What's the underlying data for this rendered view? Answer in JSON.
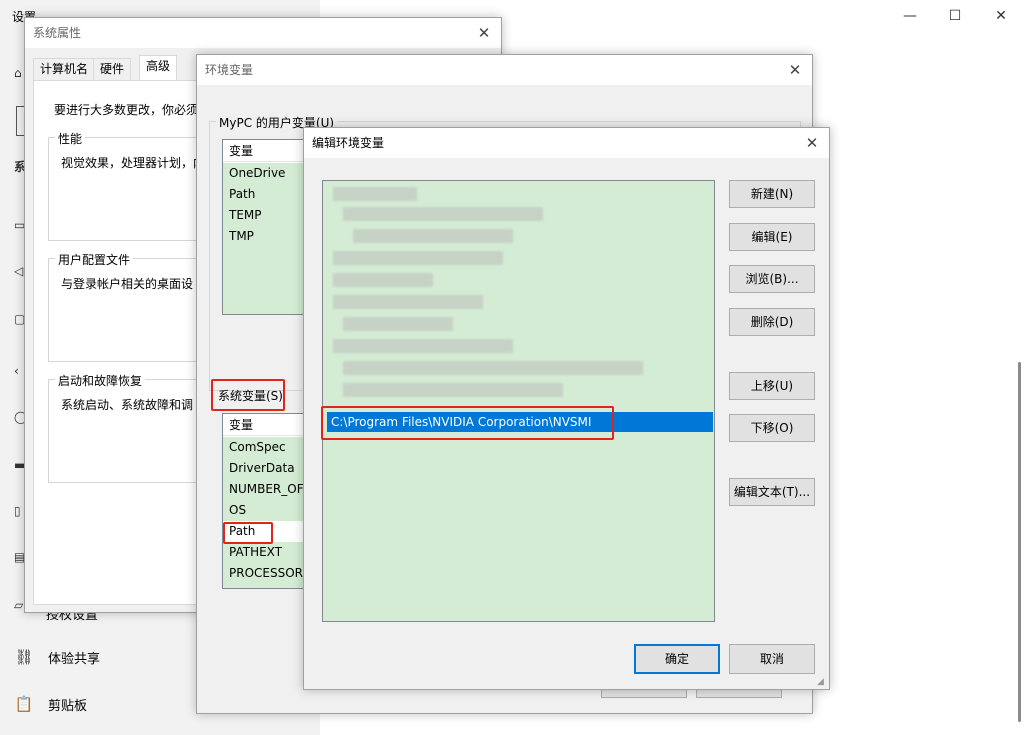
{
  "settings": {
    "title": "设置",
    "window_controls": {
      "minimize": "—",
      "maximize": "☐",
      "close": "✕"
    },
    "nav_items": [
      {
        "label": "体验共享",
        "icon": "share-icon"
      },
      {
        "label": "剪贴板",
        "icon": "clipboard-icon"
      }
    ],
    "partial_nav_item": "授权设置"
  },
  "system_properties": {
    "title": "系统属性",
    "tabs": [
      "计算机名",
      "硬件",
      "高级"
    ],
    "active_tab": "高级",
    "intro_text": "要进行大多数更改，你必须",
    "groups": [
      {
        "label": "性能",
        "text": "视觉效果，处理器计划，内"
      },
      {
        "label": "用户配置文件",
        "text": "与登录帐户相关的桌面设"
      },
      {
        "label": "启动和故障恢复",
        "text": "系统启动、系统故障和调"
      }
    ]
  },
  "environment_variables": {
    "title": "环境变量",
    "user_group_label": "MyPC 的用户变量(U)",
    "user_table": {
      "header": "变量",
      "rows": [
        "OneDrive",
        "Path",
        "TEMP",
        "TMP"
      ]
    },
    "system_group_label": "系统变量(S)",
    "system_table": {
      "header": "变量",
      "rows": [
        "ComSpec",
        "DriverData",
        "NUMBER_OF",
        "OS",
        "Path",
        "PATHEXT",
        "PROCESSOR_"
      ]
    }
  },
  "edit_env": {
    "title": "编辑环境变量",
    "selected_entry": "C:\\Program Files\\NVIDIA Corporation\\NVSMI",
    "buttons": {
      "new": "新建(N)",
      "edit": "编辑(E)",
      "browse": "浏览(B)...",
      "delete": "删除(D)",
      "move_up": "上移(U)",
      "move_down": "下移(O)",
      "edit_text": "编辑文本(T)...",
      "ok": "确定",
      "cancel": "取消"
    }
  },
  "colors": {
    "highlight": "#0078d7",
    "list_background": "#d3ecd3",
    "annotation_red": "#e1251b"
  }
}
